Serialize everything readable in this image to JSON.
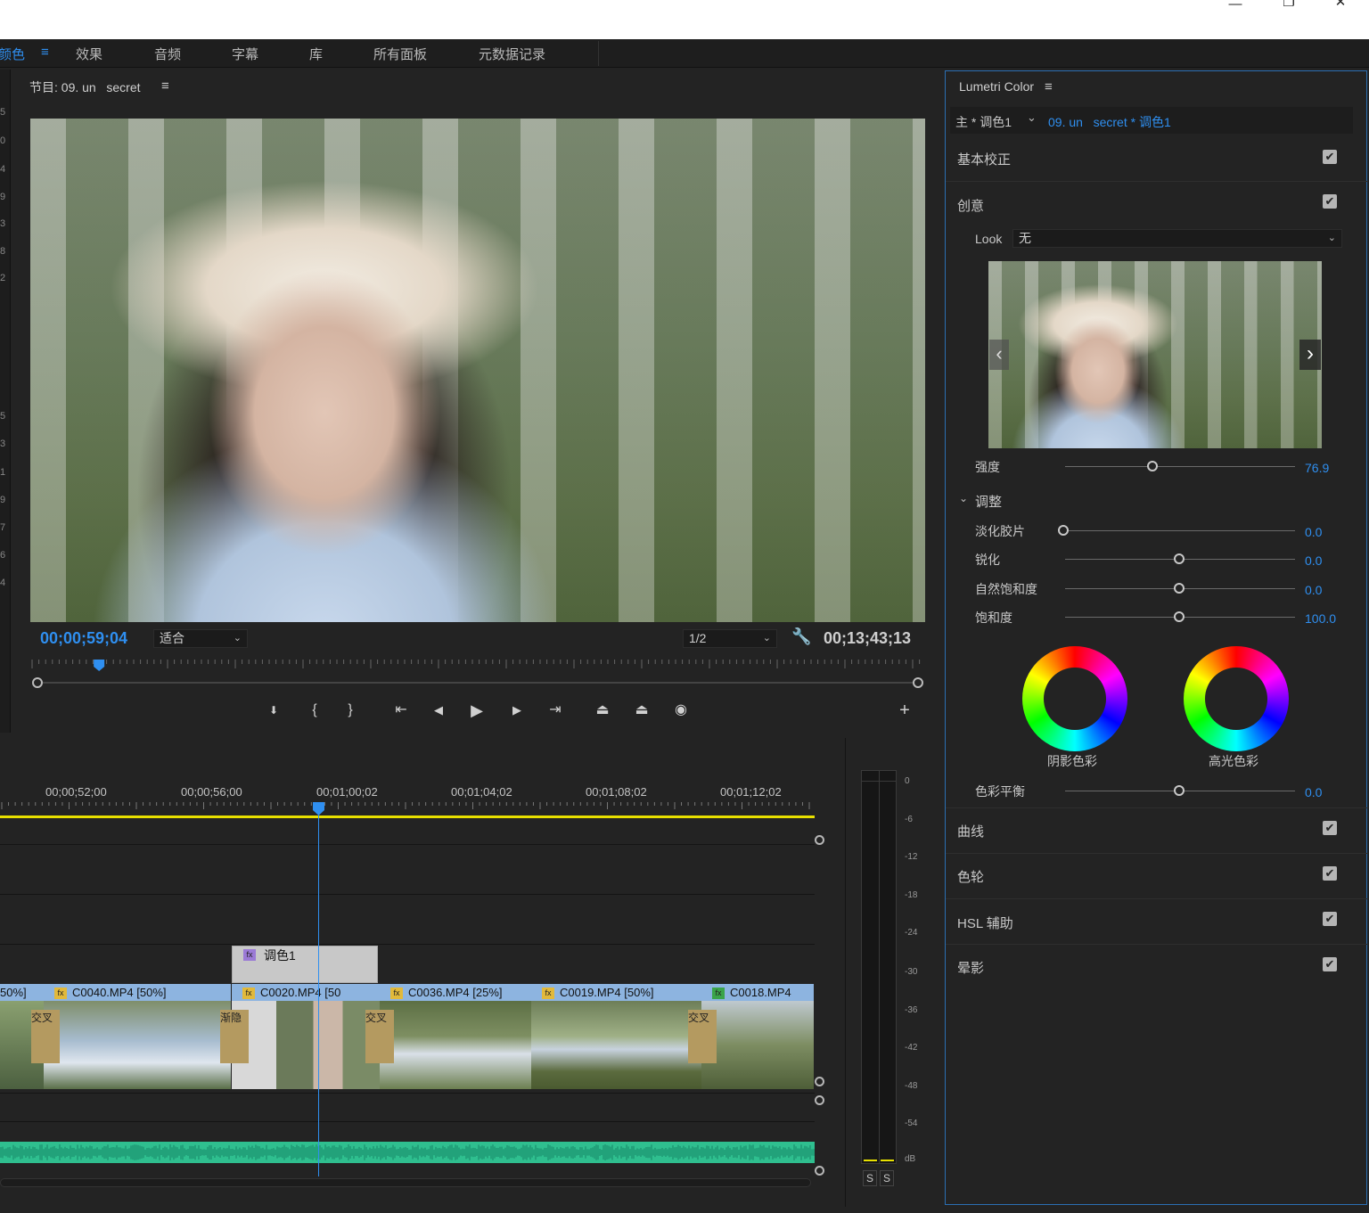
{
  "window": {
    "minimize": "—",
    "restore": "❐",
    "close": "✕"
  },
  "workspace_tabs": [
    {
      "label": "颜色",
      "active": true
    },
    {
      "label": "效果"
    },
    {
      "label": "音频"
    },
    {
      "label": "字幕"
    },
    {
      "label": "库"
    },
    {
      "label": "所有面板"
    },
    {
      "label": "元数据记录"
    }
  ],
  "left_numbers": [
    "5",
    "0",
    "4",
    "9",
    "3",
    "8",
    "2",
    "5",
    "3",
    "1",
    "9",
    "7",
    "6",
    "4"
  ],
  "program": {
    "title": "节目: 09. un   secret",
    "menu_icon": "≡",
    "playhead_timecode": "00;00;59;04",
    "fit_option": "适合",
    "resolution": "1/2",
    "duration_timecode": "00;13;43;13",
    "progress_fraction": 0.07,
    "controls": [
      {
        "name": "add-marker-button",
        "glyph": "⬇"
      },
      {
        "name": "mark-in-button",
        "glyph": "{"
      },
      {
        "name": "mark-out-button",
        "glyph": "}"
      },
      {
        "name": "go-to-in-button",
        "glyph": "⇤"
      },
      {
        "name": "step-back-button",
        "glyph": "◀"
      },
      {
        "name": "play-button",
        "glyph": "▶"
      },
      {
        "name": "step-forward-button",
        "glyph": "▶"
      },
      {
        "name": "go-to-out-button",
        "glyph": "⇥"
      },
      {
        "name": "lift-button",
        "glyph": "⏏"
      },
      {
        "name": "extract-button",
        "glyph": "⏏"
      },
      {
        "name": "export-frame-button",
        "glyph": "◉"
      }
    ],
    "add_button": "+"
  },
  "timeline": {
    "ruler_labels": [
      "00;00;52;00",
      "00;00;56;00",
      "00;01;00;02",
      "00;01;04;02",
      "00;01;08;02",
      "00;01;12;02"
    ],
    "adjustment_clip": "调色1",
    "clips": [
      {
        "label": "50%]"
      },
      {
        "label": "C0040.MP4 [50%]"
      },
      {
        "label": "C0020.MP4 [50"
      },
      {
        "label": "C0036.MP4 [25%]"
      },
      {
        "label": "C0019.MP4 [50%]"
      },
      {
        "label": "C0018.MP4"
      }
    ],
    "transitions": [
      "交叉",
      "渐隐",
      "交叉",
      "交叉"
    ],
    "fx_label": "fx"
  },
  "meter": {
    "db_labels": [
      "0",
      "-6",
      "-12",
      "-18",
      "-24",
      "-30",
      "-36",
      "-42",
      "-48",
      "-54",
      "dB"
    ],
    "solo_labels": [
      "S",
      "S"
    ]
  },
  "lumetri": {
    "title": "Lumetri Color",
    "menu_icon": "≡",
    "master_label": "主 * 调色1",
    "clip_path": "09. un   secret * 调色1",
    "sections": [
      {
        "label": "基本校正",
        "checked": true
      },
      {
        "label": "创意",
        "checked": true
      }
    ],
    "look_label": "Look",
    "look_value": "无",
    "intensity_label": "强度",
    "intensity_value": "76.9",
    "adjust_label": "调整",
    "sliders": [
      {
        "label": "淡化胶片",
        "value": "0.0"
      },
      {
        "label": "锐化",
        "value": "0.0"
      },
      {
        "label": "自然饱和度",
        "value": "0.0"
      },
      {
        "label": "饱和度",
        "value": "100.0"
      }
    ],
    "shadow_tint": "阴影色彩",
    "highlight_tint": "高光色彩",
    "balance_label": "色彩平衡",
    "balance_value": "0.0",
    "bottom_sections": [
      {
        "label": "曲线",
        "checked": true
      },
      {
        "label": "色轮",
        "checked": true
      },
      {
        "label": "HSL 辅助",
        "checked": true
      },
      {
        "label": "晕影",
        "checked": true
      }
    ],
    "check_glyph": "✔"
  },
  "colors": {
    "accent": "#2f8ff0",
    "clip_header": "#8db4e0",
    "adjustment_clip": "#c8c8c8",
    "audio_waveform": "#2fbf8f",
    "playhead_line": "#2f8ff0",
    "work_area": "#e8e000"
  }
}
